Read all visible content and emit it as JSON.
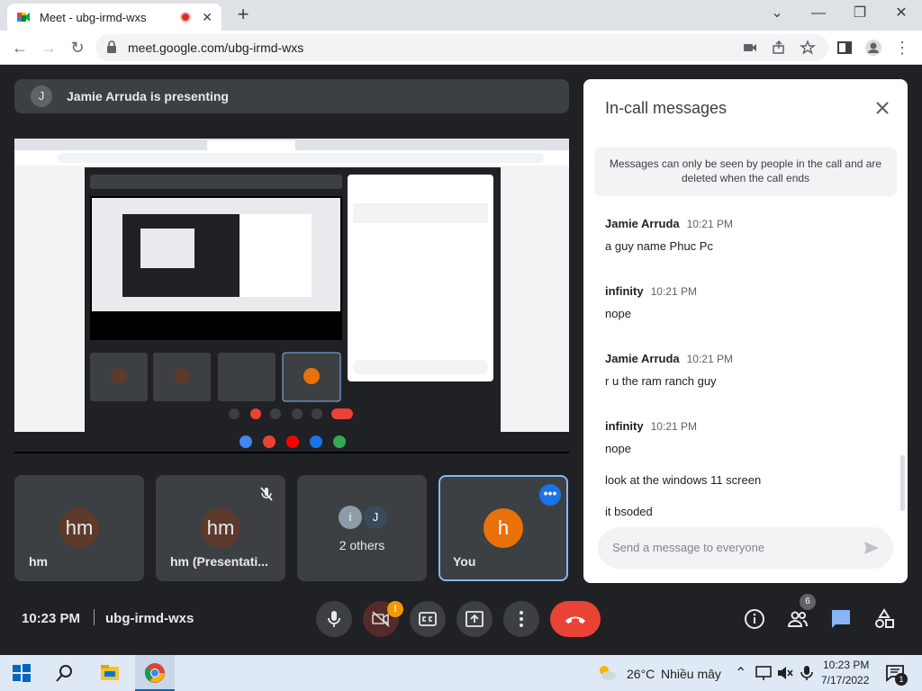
{
  "browser": {
    "tab_title": "Meet - ubg-irmd-wxs",
    "url": "meet.google.com/ubg-irmd-wxs"
  },
  "meet": {
    "presenter_initial": "J",
    "presenting_text": "Jamie Arruda is presenting",
    "time": "10:23 PM",
    "meeting_code": "ubg-irmd-wxs",
    "people_count": "6",
    "camera_warning": "!",
    "tiles": [
      {
        "initials": "hm",
        "name": "hm"
      },
      {
        "initials": "hm",
        "name": "hm (Presentati..."
      },
      {
        "initials_a": "i",
        "initials_b": "J",
        "name": "2 others"
      },
      {
        "initials": "h",
        "name": "You"
      }
    ]
  },
  "chat": {
    "title": "In-call messages",
    "notice": "Messages can only be seen by people in the call and are deleted when the call ends",
    "messages": [
      {
        "sender": "Jamie Arruda",
        "time": "10:21 PM",
        "text": "a guy name Phuc Pc"
      },
      {
        "sender": "infinity",
        "time": "10:21 PM",
        "text": "nope"
      },
      {
        "sender": "Jamie Arruda",
        "time": "10:21 PM",
        "text": "r u the ram ranch guy"
      },
      {
        "sender": "infinity",
        "time": "10:21 PM",
        "text": "nope",
        "text2": "look at the windows 11 screen",
        "text3": "it bsoded"
      }
    ],
    "input_placeholder": "Send a message to everyone"
  },
  "taskbar": {
    "temperature": "26°C",
    "weather": "Nhiều mây",
    "clock_time": "10:23 PM",
    "clock_date": "7/17/2022",
    "notification_count": "1"
  },
  "colors": {
    "meet_bg": "#202124",
    "tile_bg": "#3c4043",
    "accent_blue": "#8ab4f8",
    "end_call_red": "#ea4335",
    "avatar_orange": "#e8710a",
    "avatar_brown": "#5d3a2c"
  }
}
